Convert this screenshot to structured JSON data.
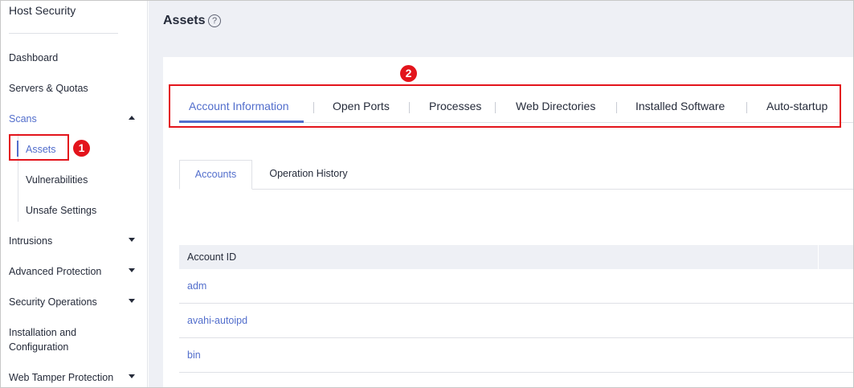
{
  "sidebar": {
    "title": "Host Security",
    "items": [
      {
        "label": "Dashboard"
      },
      {
        "label": "Servers & Quotas"
      },
      {
        "label": "Scans"
      },
      {
        "label": "Intrusions"
      },
      {
        "label": "Advanced Protection"
      },
      {
        "label": "Security Operations"
      },
      {
        "label": "Installation and Configuration"
      },
      {
        "label": "Web Tamper Protection"
      }
    ],
    "scans_children": [
      {
        "label": "Assets"
      },
      {
        "label": "Vulnerabilities"
      },
      {
        "label": "Unsafe Settings"
      }
    ]
  },
  "header": {
    "title": "Assets",
    "help_glyph": "?"
  },
  "tabs": [
    {
      "label": "Account Information"
    },
    {
      "label": "Open Ports"
    },
    {
      "label": "Processes"
    },
    {
      "label": "Web Directories"
    },
    {
      "label": "Installed Software"
    },
    {
      "label": "Auto-startup"
    }
  ],
  "subtabs": [
    {
      "label": "Accounts"
    },
    {
      "label": "Operation History"
    }
  ],
  "table": {
    "columns": [
      "Account ID"
    ],
    "rows": [
      "adm",
      "avahi-autoipd",
      "bin"
    ]
  },
  "callouts": [
    "1",
    "2"
  ],
  "colors": {
    "accent": "#526ecc",
    "callout": "#e3141c",
    "background": "#eef0f5"
  }
}
